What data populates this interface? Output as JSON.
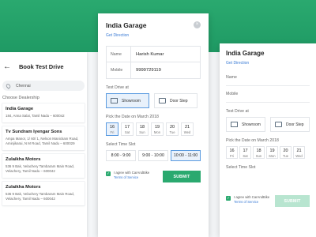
{
  "left": {
    "title": "Book Test Drive",
    "search_value": "Chennai",
    "section_label": "Choose Dealership",
    "dealers": [
      {
        "name": "India Garage",
        "address": "184, Anna Salai, Tamil Nadu – 600042"
      },
      {
        "name": "Tv Sundram Iyengar Sons",
        "address": "Ampa Manor, 1/ 60/ 1, Nelson Manickam Road, Aminjikarai, N M Road, Tamil Nadu – 600029"
      },
      {
        "name": "Zulaikha Motors",
        "address": "536 9 Bak, Velachery Tambaram Main Road, Velachery, Tamil Nadu – 600042"
      },
      {
        "name": "Zulaikha Motors",
        "address": "536 9 Bak, Velachery Tambaram Main Road, Velachery, Tamil Nadu – 600042"
      }
    ]
  },
  "center": {
    "title": "India Garage",
    "get_direction": "Get Direction",
    "close_icon": "×",
    "name_label": "Name",
    "name_value": "Harish Kumar",
    "mobile_label": "Mobile",
    "mobile_value": "9999729119",
    "test_drive_label": "Test Drive at",
    "showroom": "Showroom",
    "doorstep": "Door Step",
    "date_label": "Pick the Date on March 2018",
    "dates": [
      {
        "num": "16",
        "day": "Fri"
      },
      {
        "num": "17",
        "day": "Sat"
      },
      {
        "num": "18",
        "day": "Sun"
      },
      {
        "num": "19",
        "day": "Mon"
      },
      {
        "num": "20",
        "day": "Tue"
      },
      {
        "num": "21",
        "day": "Wed"
      }
    ],
    "time_label": "Select Time Slot",
    "times": [
      "8:00 - 9:00",
      "9:00 - 10:00",
      "10:00 - 11:00"
    ],
    "agree_text": "I agree with CarAndBike",
    "terms": "Terms of Service",
    "submit": "SUBMIT"
  },
  "right": {
    "title": "India Garage",
    "get_direction": "Get Direction",
    "name_label": "Name",
    "mobile_label": "Mobile",
    "test_drive_label": "Test Drive at",
    "showroom": "Showroom",
    "doorstep": "Door Step",
    "date_label": "Pick the Date on March 2018",
    "dates": [
      {
        "num": "16",
        "day": "Fri"
      },
      {
        "num": "17",
        "day": "Sat"
      },
      {
        "num": "18",
        "day": "Sun"
      },
      {
        "num": "19",
        "day": "Mon"
      },
      {
        "num": "20",
        "day": "Tue"
      },
      {
        "num": "21",
        "day": "Wed"
      }
    ],
    "time_label": "Select Time Slot",
    "agree_text": "I agree with CarAndBike",
    "terms": "Terms of Service",
    "submit": "SUBMIT"
  },
  "colors": {
    "accent": "#2aa96f",
    "link": "#3a7bd5",
    "selected": "#5b9be0"
  }
}
